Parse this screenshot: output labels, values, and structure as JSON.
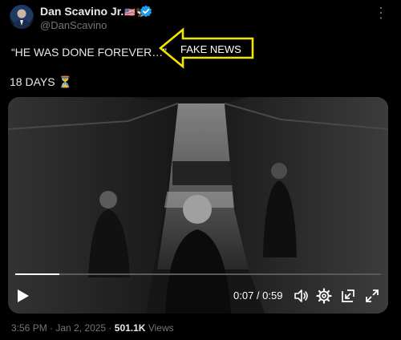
{
  "author": {
    "display_name": "Dan Scavino Jr.",
    "name_emoji": "🇺🇸🦅",
    "handle": "@DanScavino",
    "verified": true
  },
  "post": {
    "quote_text": "“HE WAS DONE FOREVER…”",
    "annotation_label": "FAKE NEWS",
    "days_text": "18 DAYS",
    "days_emoji": "⏳"
  },
  "video": {
    "time_display": "0:07 / 0:59",
    "progress_fraction": 0.12
  },
  "meta": {
    "time": "3:56 PM",
    "separator": " · ",
    "date": "Jan 2, 2025",
    "views_count": "501.1K",
    "views_label": "Views"
  },
  "colors": {
    "background": "#000000",
    "verified_badge": "#1d9bf0",
    "annotation_arrow": "#f2e600",
    "muted_text": "#71767b"
  }
}
